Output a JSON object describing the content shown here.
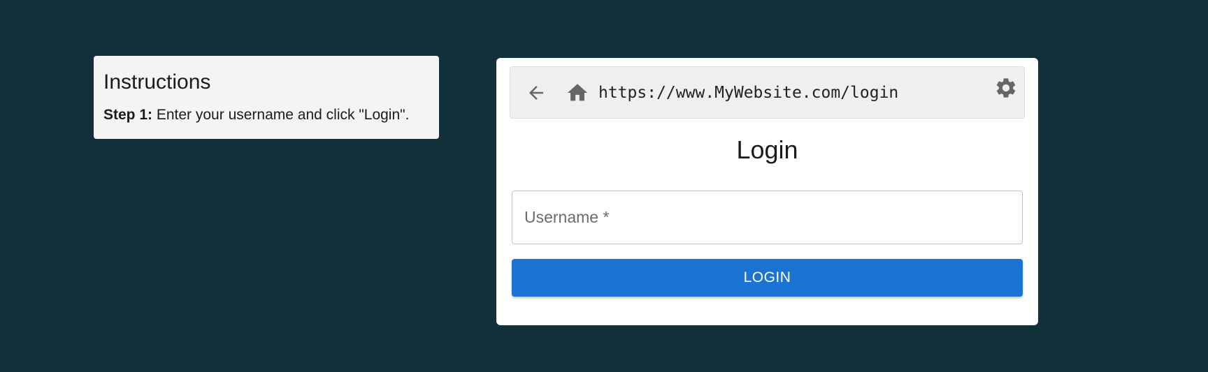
{
  "instructions": {
    "title": "Instructions",
    "step_label": "Step 1:",
    "step_text": " Enter your username and click \"Login\"."
  },
  "browser": {
    "url": "https://www.MyWebsite.com/login",
    "icons": {
      "back": "arrow-left-icon",
      "home": "home-icon",
      "settings": "gear-icon"
    },
    "icon_color": "#666666"
  },
  "login": {
    "title": "Login",
    "username_placeholder": "Username *",
    "username_value": "",
    "button_label": "LOGIN",
    "button_color": "#1b74d3"
  },
  "colors": {
    "background": "#12303a",
    "instructions_panel": "#f4f4f4",
    "address_bar": "#efefef"
  }
}
